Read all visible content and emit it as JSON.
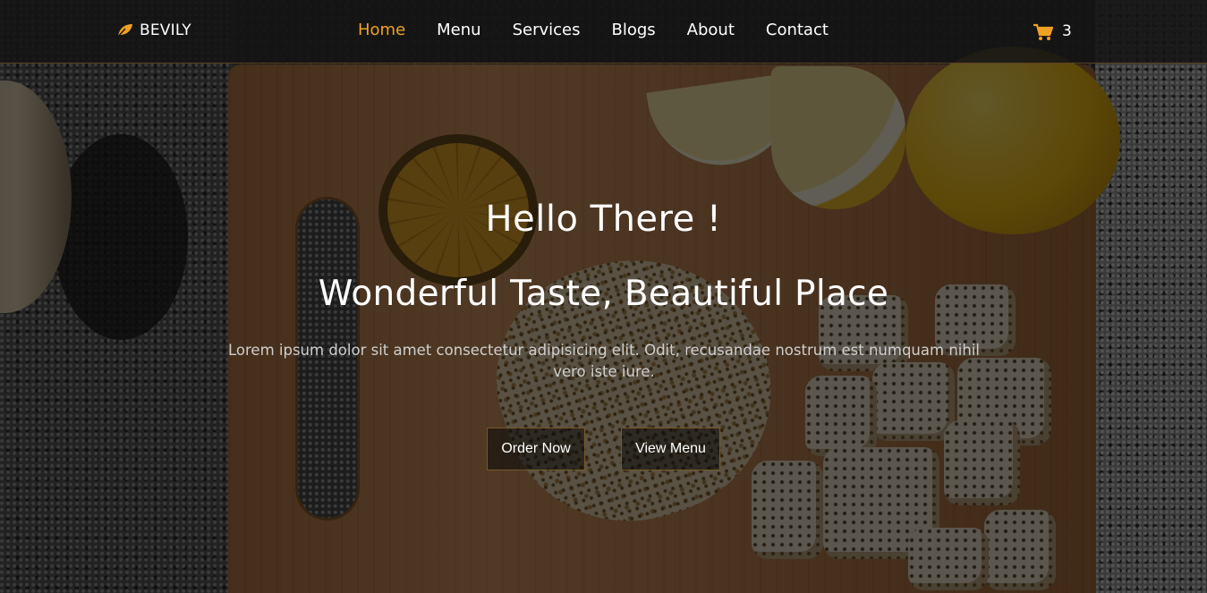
{
  "brand": {
    "name": "BEVILY",
    "icon": "leaf-icon",
    "accent_color": "#f0a023"
  },
  "nav": {
    "items": [
      {
        "label": "Home",
        "active": true
      },
      {
        "label": "Menu",
        "active": false
      },
      {
        "label": "Services",
        "active": false
      },
      {
        "label": "Blogs",
        "active": false
      },
      {
        "label": "About",
        "active": false
      },
      {
        "label": "Contact",
        "active": false
      }
    ]
  },
  "cart": {
    "icon": "shopping-cart-icon",
    "count": "3"
  },
  "hero": {
    "greeting": "Hello There !",
    "title": "Wonderful Taste, Beautiful Place",
    "text": "Lorem ipsum dolor sit amet consectetur adipisicing elit. Odit, recusandae nostrum est numquam nihil vero iste iure.",
    "buttons": {
      "order_label": "Order Now",
      "menu_label": "View Menu"
    }
  },
  "colors": {
    "accent": "#f0a023",
    "navbar_bg": "#141414",
    "text": "#ffffff"
  }
}
